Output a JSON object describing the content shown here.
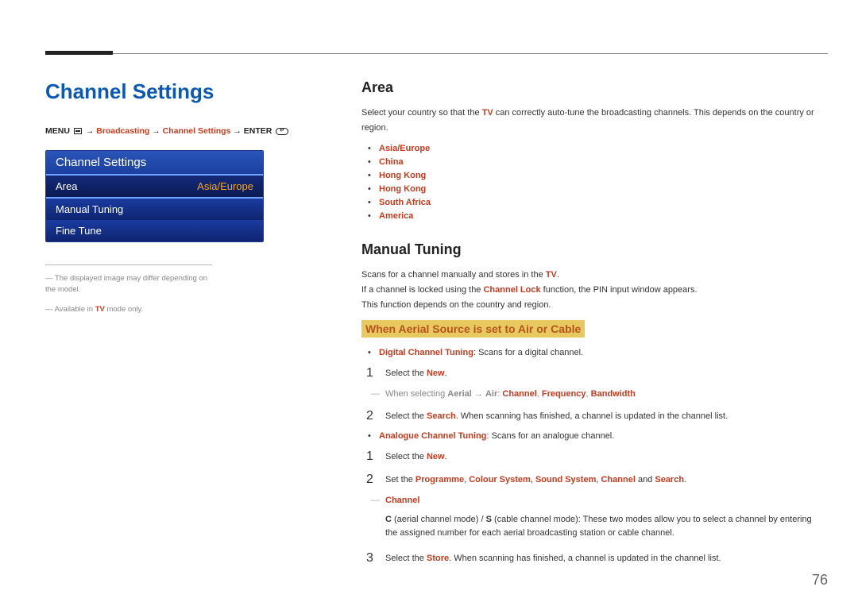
{
  "page_title": "Channel Settings",
  "breadcrumb": {
    "menu": "MENU",
    "arrow": "→",
    "broadcasting": "Broadcasting",
    "channel_settings": "Channel Settings",
    "enter": "ENTER"
  },
  "osd": {
    "title": "Channel Settings",
    "rows": [
      {
        "label": "Area",
        "value": "Asia/Europe",
        "selected": true
      },
      {
        "label": "Manual Tuning",
        "value": "",
        "selected": false
      },
      {
        "label": "Fine Tune",
        "value": "",
        "selected": false
      }
    ]
  },
  "left_notes": {
    "note1_pre": "The displayed image may differ depending on the model.",
    "note2_pre": "Available in ",
    "note2_col": "TV",
    "note2_post": " mode only."
  },
  "area": {
    "heading": "Area",
    "desc_pre": "Select your country so that the ",
    "desc_col": "TV",
    "desc_post": " can correctly auto-tune the broadcasting channels. This depends on the country or region.",
    "options": [
      "Asia/Europe",
      "China",
      "Hong Kong",
      "Hong Kong",
      "South Africa",
      "America"
    ]
  },
  "manual_tuning": {
    "heading": "Manual Tuning",
    "desc1_pre": "Scans for a channel manually and stores in the ",
    "desc1_col": "TV",
    "desc1_post": ".",
    "desc2_pre": "If a channel is locked using the ",
    "desc2_col": "Channel Lock",
    "desc2_post": " function, the PIN input window appears.",
    "desc3": "This function depends on the country and region.",
    "sub_heading": "When Aerial Source is set to Air or Cable",
    "digital": {
      "label": "Digital Channel Tuning",
      "desc": ": Scans for a digital channel.",
      "step1_pre": "Select the ",
      "step1_col": "New",
      "step1_post": ".",
      "note_pre": "When selecting ",
      "note_aerial": "Aerial",
      "note_arrow": " → ",
      "note_air": "Air",
      "note_colon": ": ",
      "note_channel": "Channel",
      "note_freq": "Frequency",
      "note_bw": "Bandwidth",
      "step2_pre": "Select the ",
      "step2_col": "Search",
      "step2_post": ". When scanning has finished, a channel is updated in the channel list."
    },
    "analogue": {
      "label": "Analogue Channel Tuning",
      "desc": ": Scans for an analogue channel.",
      "step1_pre": "Select the ",
      "step1_col": "New",
      "step1_post": ".",
      "step2_pre": "Set the ",
      "step2_prog": "Programme",
      "step2_colsys": "Colour System",
      "step2_sndsys": "Sound System",
      "step2_chan": "Channel",
      "step2_and": " and ",
      "step2_search": "Search",
      "step2_post": ".",
      "channel_note_heading": "Channel",
      "channel_note_c": "C",
      "channel_note_c_desc": " (aerial channel mode) / ",
      "channel_note_s": "S",
      "channel_note_s_desc": " (cable channel mode): These two modes allow you to select a channel by entering the assigned number for each aerial broadcasting station or cable channel.",
      "step3_pre": "Select the ",
      "step3_col": "Store",
      "step3_post": ". When scanning has finished, a channel is updated in the channel list."
    }
  },
  "page_number": "76"
}
